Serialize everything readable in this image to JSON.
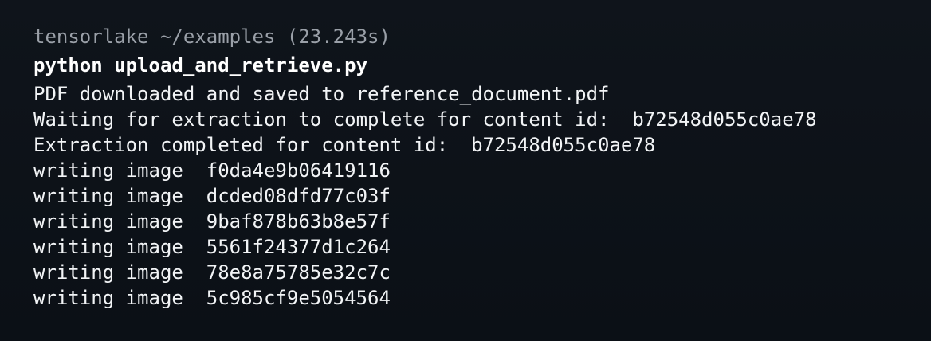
{
  "terminal": {
    "prompt": "tensorlake ~/examples (23.243s)",
    "command": "python upload_and_retrieve.py",
    "output": [
      "PDF downloaded and saved to reference_document.pdf",
      "Waiting for extraction to complete for content id:  b72548d055c0ae78",
      "Extraction completed for content id:  b72548d055c0ae78",
      "writing image  f0da4e9b06419116",
      "writing image  dcded08dfd77c03f",
      "writing image  9baf878b63b8e57f",
      "writing image  5561f24377d1c264",
      "writing image  78e8a75785e32c7c",
      "writing image  5c985cf9e5054564"
    ]
  }
}
